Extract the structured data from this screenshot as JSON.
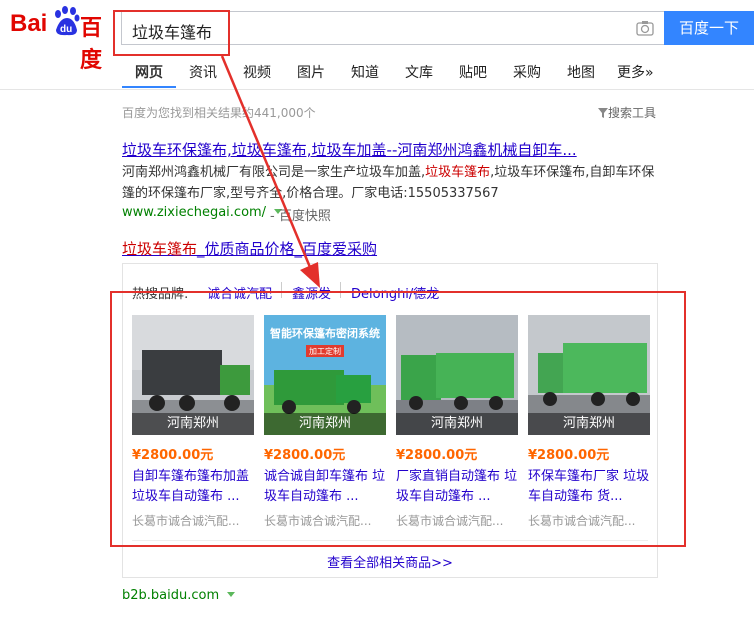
{
  "logo": {
    "part1": "Bai",
    "paw": "du",
    "part2": "百度"
  },
  "search": {
    "query": "垃圾车篷布",
    "button": "百度一下"
  },
  "tabs": [
    "网页",
    "资讯",
    "视频",
    "图片",
    "知道",
    "文库",
    "贴吧",
    "采购",
    "地图",
    "更多»"
  ],
  "result_count": "百度为您找到相关结果约441,000个",
  "search_tools": "搜索工具",
  "result1": {
    "title": "垃圾车环保篷布,垃圾车篷布,垃圾车加盖--河南郑州鸿鑫机械自卸车...",
    "abstract_a": "河南郑州鸿鑫机械厂有限公司是一家生产垃圾车加盖,",
    "abstract_hl": "垃圾车篷布",
    "abstract_b": ",垃圾车环保篷布,自卸车环保篷的环保篷布厂家,型号齐全,价格合理。厂家电话:15505337567",
    "url": "www.zixiechegai.com/",
    "cache": "- 百度快照"
  },
  "result2": {
    "title_hl": "垃圾车篷布",
    "title_rest": "_优质商品价格_百度爱采购",
    "hot_label": "热搜品牌:",
    "brands": [
      "诚合诚汽配",
      "鑫源发",
      "Delonghi/德龙"
    ],
    "products": [
      {
        "region": "河南郑州",
        "price": "¥2800.00元",
        "title": "自卸车篷布篷布加盖垃圾车自动篷布 ...",
        "seller": "长葛市诚合诚汽配..."
      },
      {
        "region": "河南郑州",
        "price": "¥2800.00元",
        "title": "诚合诚自卸车篷布 垃圾车自动篷布 ...",
        "seller": "长葛市诚合诚汽配...",
        "banner": "智能环保篷布密闭系统",
        "banner_sub": "加工定制"
      },
      {
        "region": "河南郑州",
        "price": "¥2800.00元",
        "title": "厂家直销自动篷布 垃圾车自动篷布 ...",
        "seller": "长葛市诚合诚汽配..."
      },
      {
        "region": "河南郑州",
        "price": "¥2800.00元",
        "title": "环保车篷布厂家 垃圾车自动篷布 货...",
        "seller": "长葛市诚合诚汽配..."
      }
    ],
    "view_all": "查看全部相关商品>>",
    "url": "b2b.baidu.com"
  },
  "colors": {
    "brand_blue": "#3385ff",
    "link": "#2200cc",
    "highlight": "#c00",
    "annotation": "#e3302b",
    "price": "#f60"
  }
}
